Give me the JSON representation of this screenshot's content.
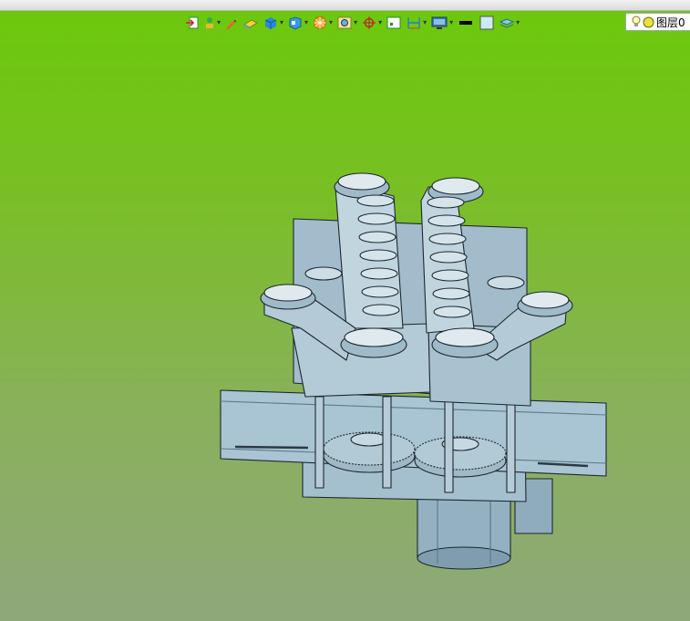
{
  "toolbar": {
    "buttons": [
      {
        "icon": "exit-sketch-icon",
        "dropdown": false
      },
      {
        "icon": "move-icon",
        "dropdown": true
      },
      {
        "icon": "pencil-icon",
        "dropdown": false
      },
      {
        "icon": "plane-icon",
        "dropdown": false
      },
      {
        "icon": "shaded-cube-icon",
        "dropdown": true
      },
      {
        "icon": "view-orientation-icon",
        "dropdown": true
      },
      {
        "icon": "render-sphere-icon",
        "dropdown": true
      },
      {
        "icon": "zoom-frame-icon",
        "dropdown": true
      },
      {
        "icon": "snap-target-icon",
        "dropdown": true
      },
      {
        "icon": "grid-square-icon",
        "dropdown": false
      },
      {
        "icon": "dimension-icon",
        "dropdown": true
      },
      {
        "icon": "display-monitor-icon",
        "dropdown": true
      },
      {
        "icon": "line-color-icon",
        "dropdown": false
      },
      {
        "icon": "fill-color-icon",
        "dropdown": false
      },
      {
        "icon": "layer-stack-icon",
        "dropdown": true
      }
    ]
  },
  "layer_selector": {
    "label": "图层0",
    "bulb_icon": "lightbulb-icon",
    "state_icon": "layer-on-icon"
  },
  "colors": {
    "background_top": "#6bc90a",
    "background_bottom": "#8fa87a",
    "model_face": "#a9c4d2",
    "model_shadow": "#7f9dae",
    "model_edge": "#1c2830"
  }
}
